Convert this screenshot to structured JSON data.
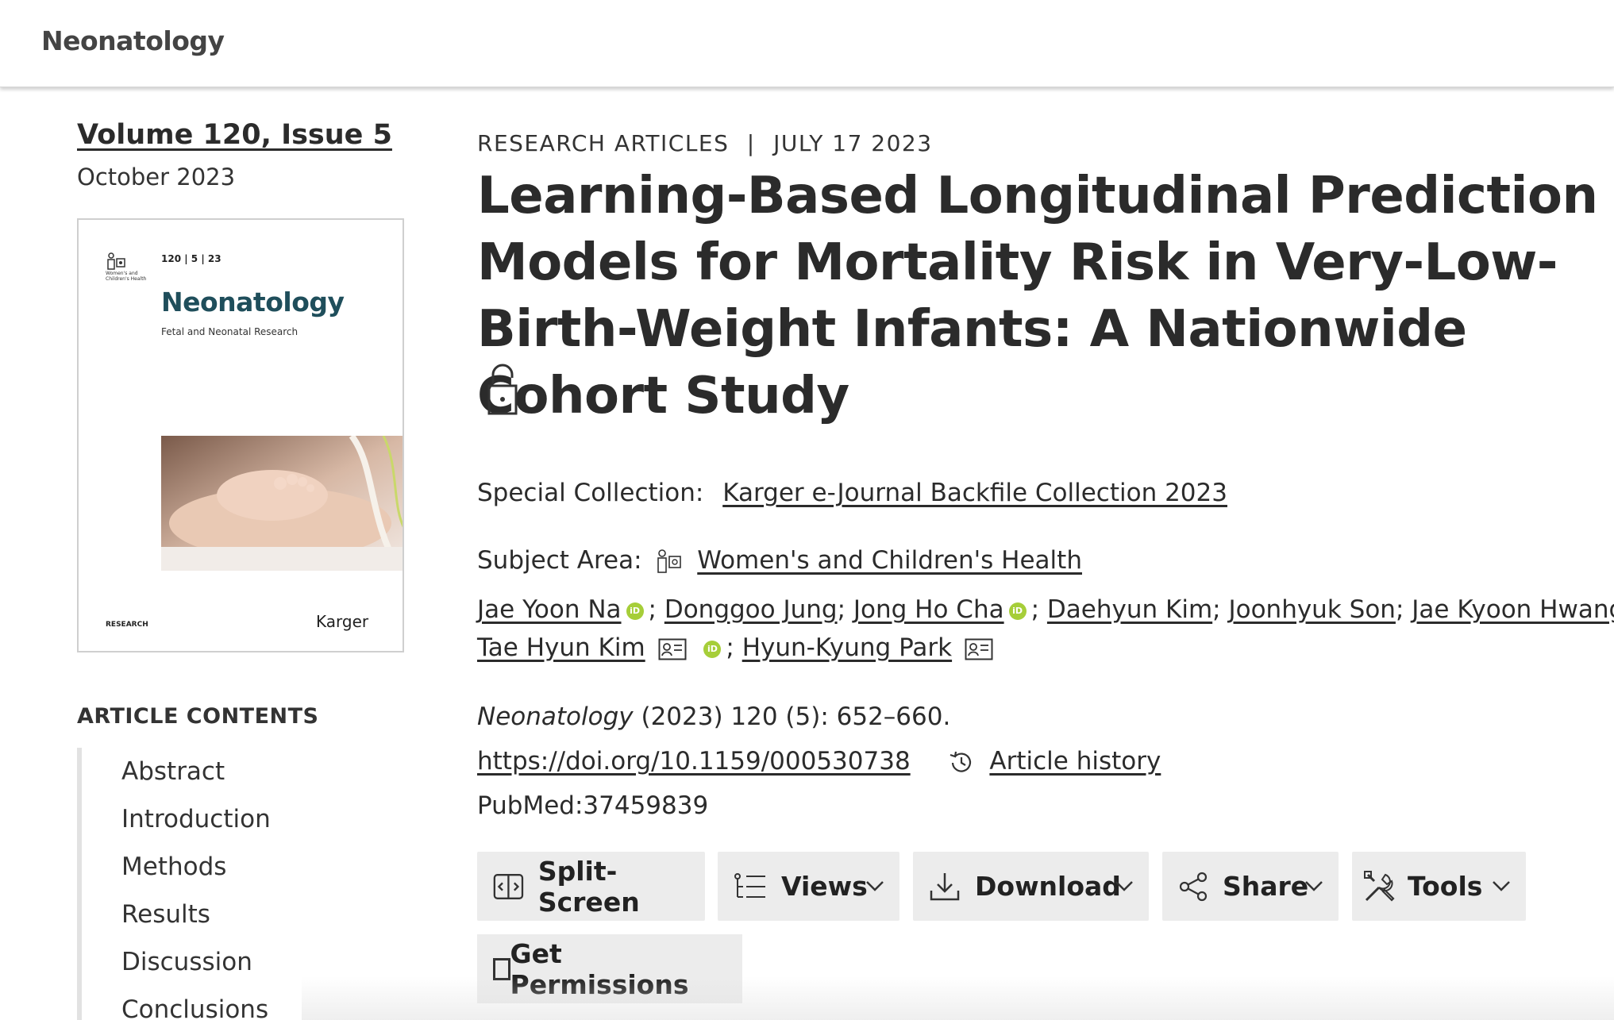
{
  "header": {
    "brand": "Neonatology"
  },
  "sidebar": {
    "issue_link": "Volume 120, Issue 5",
    "issue_date": "October 2023",
    "cover": {
      "issue_numbers": "120 | 5 | 23",
      "journal_title": "Neonatology",
      "subtitle": "Fetal and Neonatal Research",
      "section": "RESEARCH",
      "publisher": "Karger",
      "subject_tiny": "Women's and Children's Health"
    },
    "contents_heading": "ARTICLE CONTENTS",
    "contents": [
      "Abstract",
      "Introduction",
      "Methods",
      "Results",
      "Discussion",
      "Conclusions"
    ]
  },
  "article": {
    "category": "RESEARCH ARTICLES",
    "separator": "|",
    "date": "JULY 17 2023",
    "title": "Learning-Based Longitudinal Prediction Models for Mortality Risk in Very-Low-Birth-Weight Infants: A Nationwide Cohort Study",
    "special_collection_label": "Special Collection:",
    "special_collection": "Karger e-Journal Backfile Collection 2023",
    "subject_area_label": "Subject Area:",
    "subject_area": "Women's and Children's Health",
    "authors": [
      "Jae Yoon Na",
      "Donggoo Jung",
      "Jong Ho Cha",
      "Daehyun Kim",
      "Joonhyuk Son",
      "Jae Kyoon Hwang",
      "Tae Hyun Kim",
      "Hyun-Kyung Park"
    ],
    "citation_journal": "Neonatology",
    "citation_rest": "(2023) 120 (5): 652–660.",
    "doi": "https://doi.org/10.1159/000530738",
    "article_history": "Article history",
    "pubmed": "PubMed:37459839"
  },
  "toolbar": {
    "split_screen": "Split-Screen",
    "views": "Views",
    "download": "Download",
    "share": "Share",
    "tools": "Tools",
    "get_permissions": "Get Permissions"
  },
  "colors": {
    "orcid": "#a6ce39",
    "cover_title": "#1f4e5b",
    "button_bg": "#ececec"
  }
}
